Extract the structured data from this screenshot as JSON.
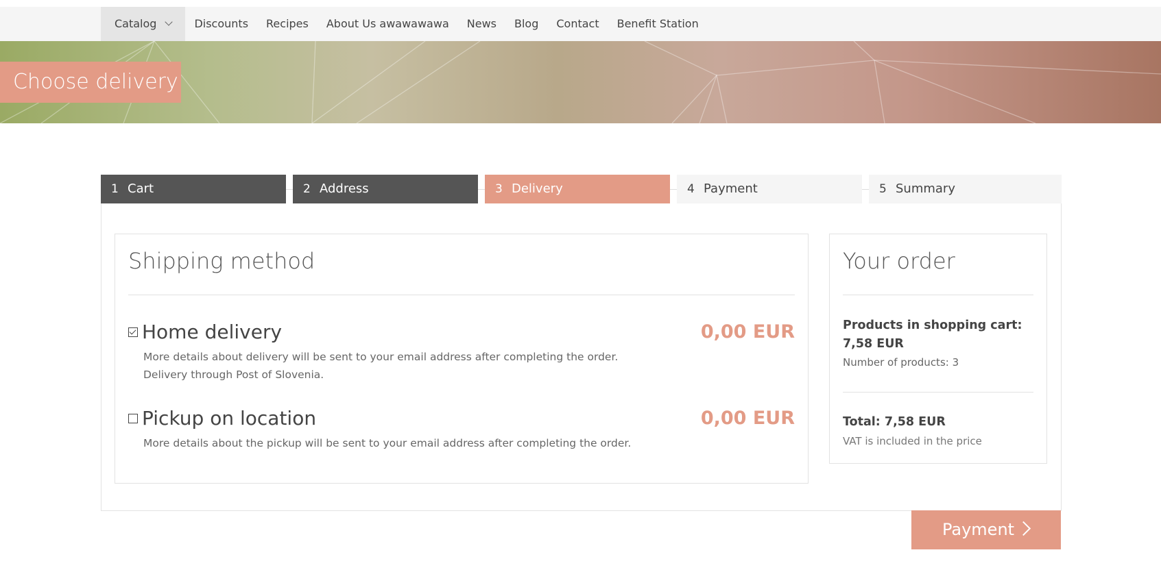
{
  "nav": {
    "items": [
      {
        "label": "Catalog"
      },
      {
        "label": "Discounts"
      },
      {
        "label": "Recipes"
      },
      {
        "label": "About Us awawawawa"
      },
      {
        "label": "News"
      },
      {
        "label": "Blog"
      },
      {
        "label": "Contact"
      },
      {
        "label": "Benefit Station"
      }
    ]
  },
  "hero": {
    "title": "Choose delivery"
  },
  "steps": [
    {
      "num": "1",
      "label": "Cart",
      "state": "done"
    },
    {
      "num": "2",
      "label": "Address",
      "state": "done"
    },
    {
      "num": "3",
      "label": "Delivery",
      "state": "current"
    },
    {
      "num": "4",
      "label": "Payment",
      "state": "todo"
    },
    {
      "num": "5",
      "label": "Summary",
      "state": "todo"
    }
  ],
  "shipping": {
    "title": "Shipping method",
    "options": [
      {
        "name": "Home delivery",
        "price": "0,00 EUR",
        "checked": true,
        "desc_line1": "More details about delivery will be sent to your email address after completing the order.",
        "desc_line2": "Delivery through Post of Slovenia."
      },
      {
        "name": "Pickup on location",
        "price": "0,00 EUR",
        "checked": false,
        "desc_line1": "More details about the pickup will be sent to your email address after completing the order."
      }
    ]
  },
  "order": {
    "title": "Your order",
    "products_line": "Products in shopping cart: 7,58 EUR",
    "count_line": "Number of products: 3",
    "total_line": "Total: 7,58 EUR",
    "vat_line": "VAT is included in the price"
  },
  "payment_button": {
    "label": "Payment"
  },
  "colors": {
    "accent": "#e39b86",
    "step_done": "#555555",
    "step_todo": "#f5f5f5"
  }
}
